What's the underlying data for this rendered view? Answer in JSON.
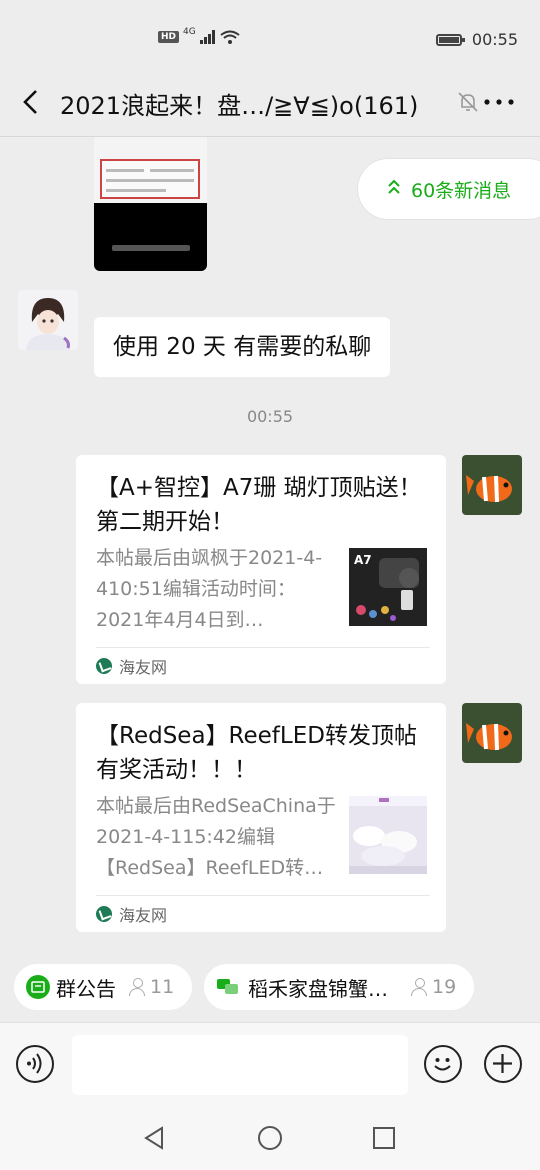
{
  "status_bar": {
    "network": "4G",
    "hd": "HD",
    "time": "00:55"
  },
  "header": {
    "title": "2021浪起来！盘…/≧∀≦)o(161)"
  },
  "new_messages": {
    "label": "60条新消息"
  },
  "messages": [
    {
      "type": "text",
      "text": "使用 20 天   有需要的私聊"
    }
  ],
  "timestamp": "00:55",
  "cards": [
    {
      "title": "【A+智控】A7珊 瑚灯顶贴送！第二期开始！",
      "desc": "本帖最后由飒枫于2021-4-410:51编辑活动时间：2021年4月4日到…",
      "source": "海友网",
      "thumb_label": "A7"
    },
    {
      "title": "【RedSea】ReefLED转发顶帖有奖活动！！！",
      "desc": "本帖最后由RedSeaChina于2021-4-115:42编辑【RedSea】ReefLED转…",
      "source": "海友网"
    }
  ],
  "quick_bar": [
    {
      "label": "群公告",
      "count": "11"
    },
    {
      "label": "稻禾家盘锦蟹…",
      "count": "19"
    }
  ],
  "colors": {
    "accent_green": "#1aad19",
    "background": "#ededed"
  }
}
